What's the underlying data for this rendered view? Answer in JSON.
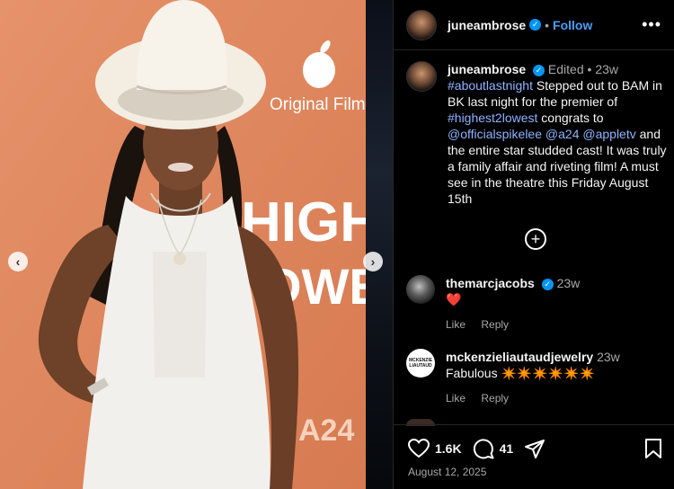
{
  "post": {
    "username": "juneambrose",
    "follow_label": "Follow",
    "more_label": "•••",
    "dot_separator": "•",
    "caption": {
      "username": "juneambrose",
      "edited_label": "Edited",
      "dot_separator": "•",
      "age": "23w",
      "hashtag1": "#aboutlastnight",
      "text1": " Stepped out to BAM in BK last night for the premier of ",
      "hashtag2": "#highest2lowest",
      "text2": " congrats to ",
      "mention1": "@officialspikelee",
      "text3": " ",
      "mention2": "@a24",
      "text4": " ",
      "mention3": "@appletv",
      "text5": " and the entire star studded cast! It was truly a family affair and riveting film! A must see in the theatre this Friday August 15th"
    },
    "add_comments_symbol": "+",
    "comments": [
      {
        "username": "themarcjacobs",
        "age": "23w",
        "text": "❤️",
        "like_label": "Like",
        "reply_label": "Reply"
      },
      {
        "username": "mckenzieliautaudjewelry",
        "age": "23w",
        "text": "Fabulous ✴️✴️✴️✴️✴️✴️",
        "like_label": "Like",
        "reply_label": "Reply",
        "avatar_text": "MCKENZIE LIAUTAUD"
      }
    ],
    "likes": "1.6K",
    "comments_count": "41",
    "date": "August 12, 2025"
  },
  "media": {
    "backdrop_text": {
      "brand": "Original Films",
      "title_top": "HIGHE",
      "title_bottom": "OWE",
      "studio": "A24"
    },
    "prev_symbol": "‹",
    "next_symbol": "›"
  },
  "colors": {
    "background": "#000000",
    "link": "#8fb2ff",
    "follow": "#4a9ef6",
    "verified": "#0095f6",
    "backdrop": "#e3845a",
    "heart": "#ff3355"
  }
}
